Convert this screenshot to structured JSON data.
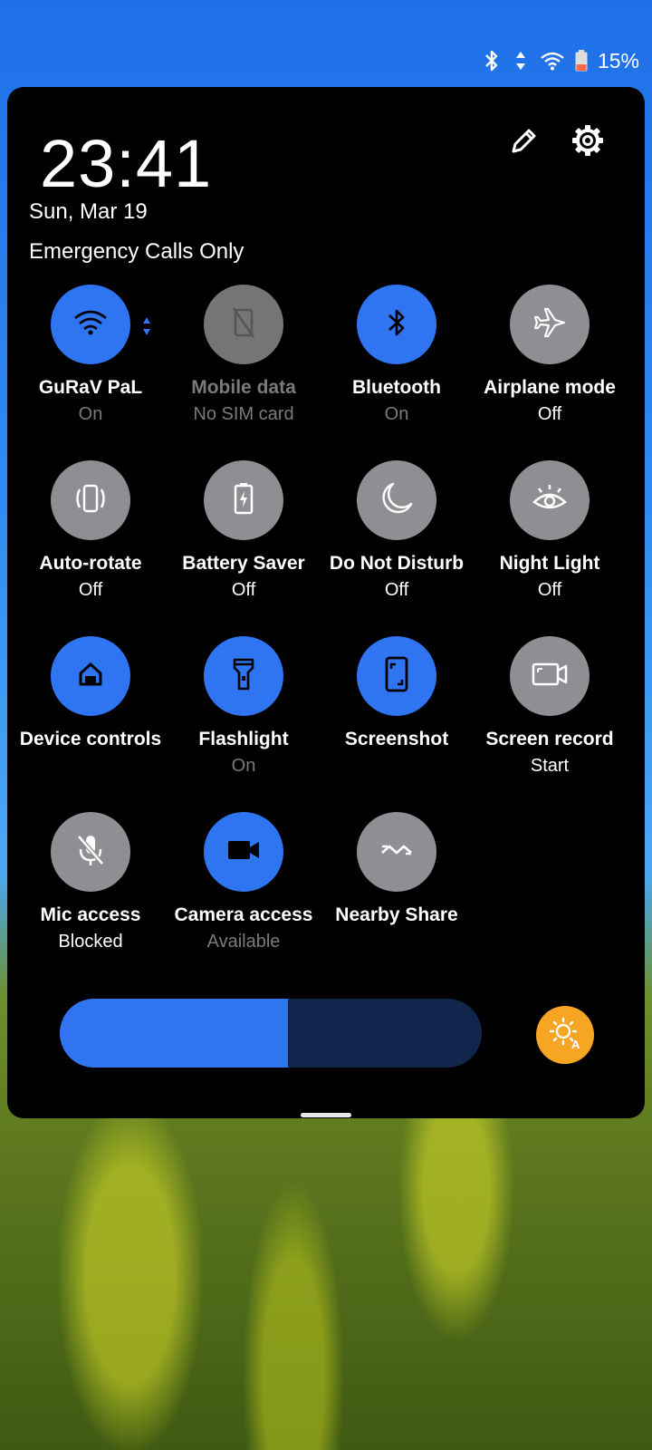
{
  "status_bar": {
    "battery_percent": "15%",
    "icons": [
      "bluetooth-icon",
      "data-arrows-icon",
      "wifi-icon",
      "battery-low-icon"
    ],
    "battery_color": "#ff6b4a"
  },
  "header": {
    "time": "23:41",
    "date": "Sun, Mar 19",
    "carrier": "Emergency Calls Only",
    "actions": [
      "edit-icon",
      "settings-icon"
    ]
  },
  "colors": {
    "tile_on": "#2f74f0",
    "tile_off": "#8e8e93",
    "auto_brightness": "#f6a623",
    "panel": "#000000"
  },
  "tiles": [
    {
      "label": "GuRaV PaL",
      "status": "On",
      "state": "on",
      "icon": "wifi-icon"
    },
    {
      "label": "Mobile data",
      "status": "No SIM card",
      "state": "unavailable",
      "icon": "mobile-data-icon"
    },
    {
      "label": "Bluetooth",
      "status": "On",
      "state": "on",
      "icon": "bluetooth-icon"
    },
    {
      "label": "Airplane mode",
      "status": "Off",
      "state": "off",
      "icon": "airplane-icon"
    },
    {
      "label": "Auto-rotate",
      "status": "Off",
      "state": "off",
      "icon": "auto-rotate-icon"
    },
    {
      "label": "Battery Saver",
      "status": "Off",
      "state": "off",
      "icon": "battery-saver-icon"
    },
    {
      "label": "Do Not Disturb",
      "status": "Off",
      "state": "off",
      "icon": "moon-icon"
    },
    {
      "label": "Night Light",
      "status": "Off",
      "state": "off",
      "icon": "eye-icon"
    },
    {
      "label": "Device controls",
      "status": "",
      "state": "on",
      "icon": "home-icon"
    },
    {
      "label": "Flashlight",
      "status": "On",
      "state": "on",
      "icon": "flashlight-icon"
    },
    {
      "label": "Screenshot",
      "status": "",
      "state": "on",
      "icon": "screenshot-icon"
    },
    {
      "label": "Screen record",
      "status": "Start",
      "state": "off",
      "icon": "screen-record-icon"
    },
    {
      "label": "Mic access",
      "status": "Blocked",
      "state": "off",
      "icon": "mic-off-icon"
    },
    {
      "label": "Camera access",
      "status": "Available",
      "state": "on",
      "icon": "video-camera-icon"
    },
    {
      "label": "Nearby Share",
      "status": "",
      "state": "off",
      "icon": "nearby-share-icon"
    }
  ],
  "brightness": {
    "level_percent": 54
  }
}
